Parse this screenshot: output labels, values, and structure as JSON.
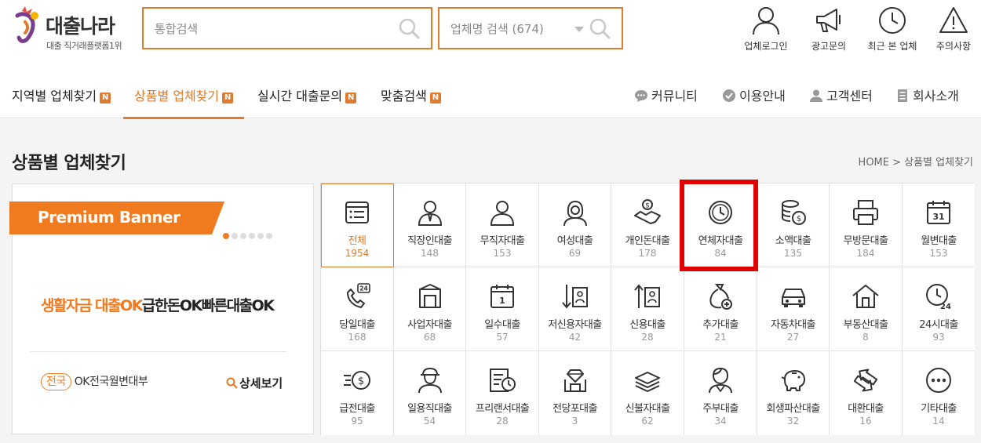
{
  "header": {
    "logo_title": "대출나라",
    "logo_sub": "대출 직거래플랫폼1위",
    "search_placeholder": "통합검색",
    "company_search_label": "업체명 검색 (674)",
    "icons": [
      {
        "label": "업체로그인",
        "icon": "person-icon"
      },
      {
        "label": "광고문의",
        "icon": "megaphone-icon"
      },
      {
        "label": "최근 본 업체",
        "icon": "clock-icon"
      },
      {
        "label": "주의사항",
        "icon": "warning-icon"
      }
    ]
  },
  "nav": {
    "items": [
      {
        "label": "지역별 업체찾기",
        "badge": "N"
      },
      {
        "label": "상품별 업체찾기",
        "badge": "N"
      },
      {
        "label": "실시간 대출문의",
        "badge": "N"
      },
      {
        "label": "맞춤검색",
        "badge": "N"
      }
    ],
    "right": [
      {
        "label": "커뮤니티",
        "icon": "chat-icon"
      },
      {
        "label": "이용안내",
        "icon": "check-circle-icon"
      },
      {
        "label": "고객센터",
        "icon": "user-icon"
      },
      {
        "label": "회사소개",
        "icon": "building-icon"
      }
    ]
  },
  "page": {
    "title": "상품별 업체찾기",
    "breadcrumb": "HOME > 상품별 업체찾기"
  },
  "banner": {
    "tag": "Premium Banner",
    "slogan_1": "생활자금 대출OK",
    "slogan_2": "급한돈OK빠른대출OK",
    "region_tag": "전국",
    "company": "OK전국월변대부",
    "detail_label": "상세보기"
  },
  "categories": [
    {
      "name": "전체",
      "count": "1954",
      "icon": "list-icon"
    },
    {
      "name": "직장인대출",
      "count": "148",
      "icon": "office-worker-icon"
    },
    {
      "name": "무직자대출",
      "count": "153",
      "icon": "person-icon"
    },
    {
      "name": "여성대출",
      "count": "69",
      "icon": "woman-icon"
    },
    {
      "name": "개인돈대출",
      "count": "178",
      "icon": "handshake-icon"
    },
    {
      "name": "연체자대출",
      "count": "84",
      "icon": "clock-icon"
    },
    {
      "name": "소액대출",
      "count": "135",
      "icon": "coins-icon"
    },
    {
      "name": "무방문대출",
      "count": "184",
      "icon": "printer-icon"
    },
    {
      "name": "월변대출",
      "count": "153",
      "icon": "calendar-31-icon"
    },
    {
      "name": "당일대출",
      "count": "168",
      "icon": "phone-24-icon"
    },
    {
      "name": "사업자대출",
      "count": "68",
      "icon": "store-icon"
    },
    {
      "name": "일수대출",
      "count": "57",
      "icon": "calendar-1-icon"
    },
    {
      "name": "저신용자대출",
      "count": "42",
      "icon": "arrow-down-id-icon"
    },
    {
      "name": "신용대출",
      "count": "28",
      "icon": "arrow-up-id-icon"
    },
    {
      "name": "추가대출",
      "count": "21",
      "icon": "money-bag-plus-icon"
    },
    {
      "name": "자동차대출",
      "count": "27",
      "icon": "car-icon"
    },
    {
      "name": "부동산대출",
      "count": "8",
      "icon": "house-icon"
    },
    {
      "name": "24시대출",
      "count": "93",
      "icon": "clock-24-icon"
    },
    {
      "name": "급전대출",
      "count": "95",
      "icon": "fast-dollar-icon"
    },
    {
      "name": "일용직대출",
      "count": "54",
      "icon": "worker-icon"
    },
    {
      "name": "프리랜서대출",
      "count": "28",
      "icon": "document-clock-icon"
    },
    {
      "name": "전당포대출",
      "count": "3",
      "icon": "pawn-jewel-icon"
    },
    {
      "name": "신불자대출",
      "count": "62",
      "icon": "cash-stack-icon"
    },
    {
      "name": "주부대출",
      "count": "34",
      "icon": "housewife-icon"
    },
    {
      "name": "회생파산대출",
      "count": "32",
      "icon": "piggy-bank-icon"
    },
    {
      "name": "대환대출",
      "count": "16",
      "icon": "exchange-arrows-icon"
    },
    {
      "name": "기타대출",
      "count": "14",
      "icon": "more-dots-icon"
    }
  ],
  "colors": {
    "accent": "#e07a2c",
    "highlight": "#e00000"
  }
}
